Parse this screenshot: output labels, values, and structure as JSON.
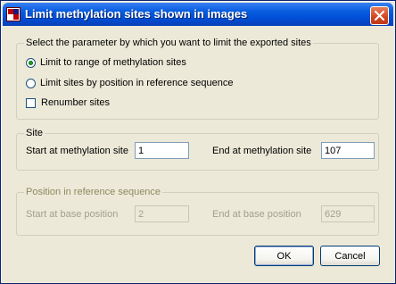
{
  "window": {
    "title": "Limit methylation sites shown in images",
    "app_icon": "methyl-app-icon",
    "close_icon": "close-icon"
  },
  "parameter_group": {
    "legend": "Select the parameter by which you want to limit the exported sites",
    "options": [
      {
        "label": "Limit to range of methylation sites",
        "checked": true
      },
      {
        "label": "Limit sites by position in reference sequence",
        "checked": false
      }
    ],
    "renumber": {
      "label": "Renumber sites",
      "checked": false
    }
  },
  "site_group": {
    "legend": "Site",
    "start_label": "Start at methylation site",
    "start_value": "1",
    "end_label": "End at methylation site",
    "end_value": "107"
  },
  "position_group": {
    "legend": "Position in reference sequence",
    "enabled": false,
    "start_label": "Start at base position",
    "start_value": "2",
    "end_label": "End at base position",
    "end_value": "629"
  },
  "buttons": {
    "ok": "OK",
    "cancel": "Cancel"
  },
  "colors": {
    "title_bar": "#0a5fe0",
    "group_legend": "#0046d5",
    "disabled_text": "#a19f8f"
  }
}
